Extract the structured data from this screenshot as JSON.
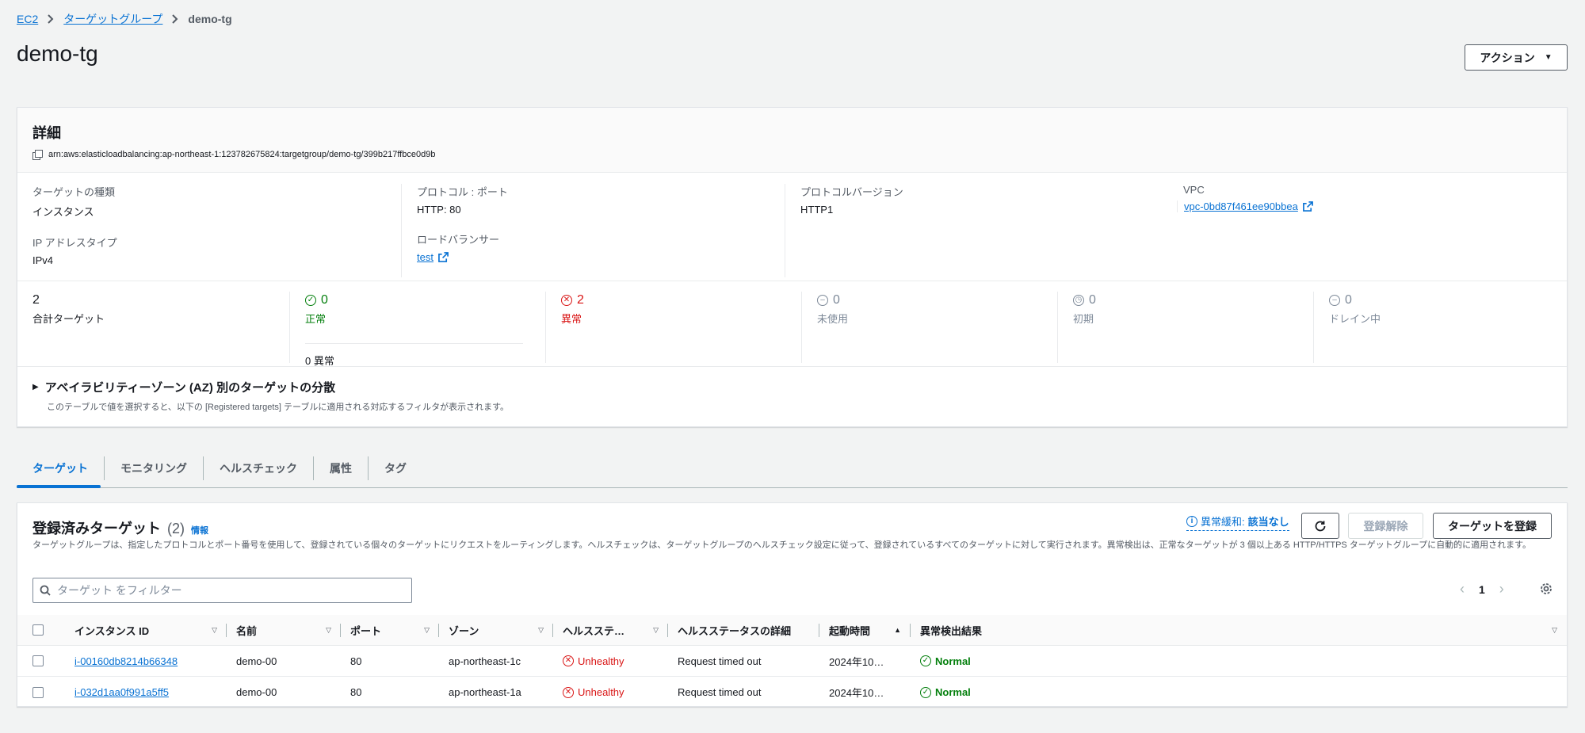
{
  "breadcrumb": [
    "EC2",
    "ターゲットグループ",
    "demo-tg"
  ],
  "title": "demo-tg",
  "action_button": "アクション",
  "details": {
    "heading": "詳細",
    "arn": "arn:aws:elasticloadbalancing:ap-northeast-1:123782675824:targetgroup/demo-tg/399b217ffbce0d9b",
    "target_type_label": "ターゲットの種類",
    "target_type": "インスタンス",
    "ip_type_label": "IP アドレスタイプ",
    "ip_type": "IPv4",
    "protocol_port_label": "プロトコル : ポート",
    "protocol_port": "HTTP: 80",
    "load_balancer_label": "ロードバランサー",
    "load_balancer": "test",
    "protocol_version_label": "プロトコルバージョン",
    "protocol_version": "HTTP1",
    "vpc_label": "VPC",
    "vpc": "vpc-0bd87f461ee90bbea"
  },
  "status": {
    "total": "2",
    "total_label": "合計ターゲット",
    "healthy": "0",
    "healthy_label": "正常",
    "healthy_sub": "0 異常",
    "unhealthy": "2",
    "unhealthy_label": "異常",
    "unused": "0",
    "unused_label": "未使用",
    "initial": "0",
    "initial_label": "初期",
    "draining": "0",
    "draining_label": "ドレイン中"
  },
  "az": {
    "title": "アベイラビリティーゾーン (AZ) 別のターゲットの分散",
    "desc": "このテーブルで値を選択すると、以下の [Registered targets] テーブルに適用される対応するフィルタが表示されます。"
  },
  "tabs": [
    "ターゲット",
    "モニタリング",
    "ヘルスチェック",
    "属性",
    "タグ"
  ],
  "targets": {
    "title": "登録済みターゲット",
    "count": "(2)",
    "info": "情報",
    "desc": "ターゲットグループは、指定したプロトコルとポート番号を使用して、登録されている個々のターゲットにリクエストをルーティングします。ヘルスチェックは、ターゲットグループのヘルスチェック設定に従って、登録されているすべてのターゲットに対して実行されます。異常検出は、正常なターゲットが 3 個以上ある HTTP/HTTPS ターゲットグループに自動的に適用されます。",
    "anomaly_label": "異常緩和:",
    "anomaly_value": "該当なし",
    "deregister": "登録解除",
    "register": "ターゲットを登録",
    "filter_placeholder": "ターゲット をフィルター",
    "page": "1",
    "columns": [
      "インスタンス ID",
      "名前",
      "ポート",
      "ゾーン",
      "ヘルスステ…",
      "ヘルスステータスの詳細",
      "起動時間",
      "異常検出結果"
    ],
    "rows": [
      {
        "id": "i-00160db8214b66348",
        "name": "demo-00",
        "port": "80",
        "zone": "ap-northeast-1c",
        "health": "Unhealthy",
        "detail": "Request timed out",
        "launch": "2024年10…",
        "anomaly": "Normal"
      },
      {
        "id": "i-032d1aa0f991a5ff5",
        "name": "demo-00",
        "port": "80",
        "zone": "ap-northeast-1a",
        "health": "Unhealthy",
        "detail": "Request timed out",
        "launch": "2024年10…",
        "anomaly": "Normal"
      }
    ]
  },
  "colors": {
    "link": "#0972d3",
    "healthy": "#037f0c",
    "unhealthy": "#d91515"
  }
}
